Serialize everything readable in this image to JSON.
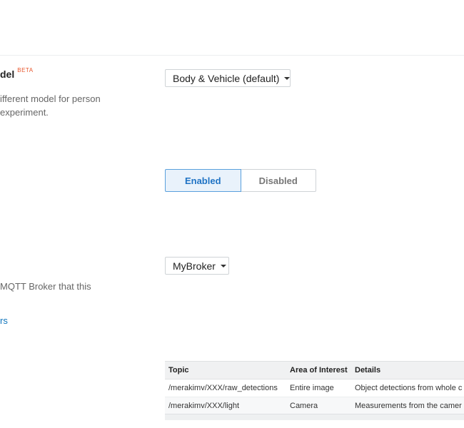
{
  "model_setting": {
    "heading": "del",
    "badge": "BETA",
    "description_lines": [
      "ifferent model for person",
      " experiment."
    ],
    "dropdown_value": "Body & Vehicle (default)"
  },
  "state_setting": {
    "options": [
      {
        "label": "Enabled",
        "selected": true
      },
      {
        "label": "Disabled",
        "selected": false
      }
    ]
  },
  "broker_setting": {
    "description": " MQTT Broker that this",
    "link_text": "rs",
    "dropdown_value": "MyBroker"
  },
  "topics_table": {
    "columns": [
      "Topic",
      "Area of Interest",
      "Details"
    ],
    "rows": [
      {
        "topic": "/merakimv/XXX/raw_detections",
        "area": "Entire image",
        "details": "Object detections from whole c"
      },
      {
        "topic": "/merakimv/XXX/light",
        "area": "Camera",
        "details": "Measurements from the camer"
      }
    ]
  },
  "colors": {
    "accent": "#1f73c4",
    "link": "#0f75bc",
    "beta": "#e8572e",
    "selected_bg": "#e9f2fb"
  }
}
